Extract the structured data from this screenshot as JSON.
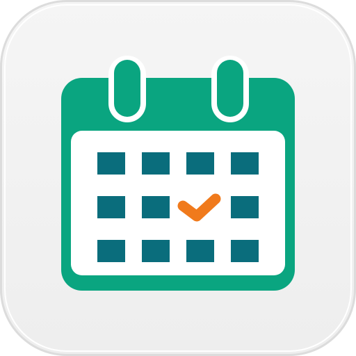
{
  "app_icon": {
    "name": "calendar-app-icon",
    "colors": {
      "tile_background": "#f0f0f0",
      "tile_edge": "#dcdcdc",
      "calendar_green": "#0aa580",
      "calendar_face": "#ffffff",
      "day_cells": "#0a6d7c",
      "check_mark": "#f07a1c"
    },
    "grid": {
      "rows": 3,
      "columns": 4,
      "checked_cell": {
        "row": 2,
        "column": 3
      }
    }
  }
}
